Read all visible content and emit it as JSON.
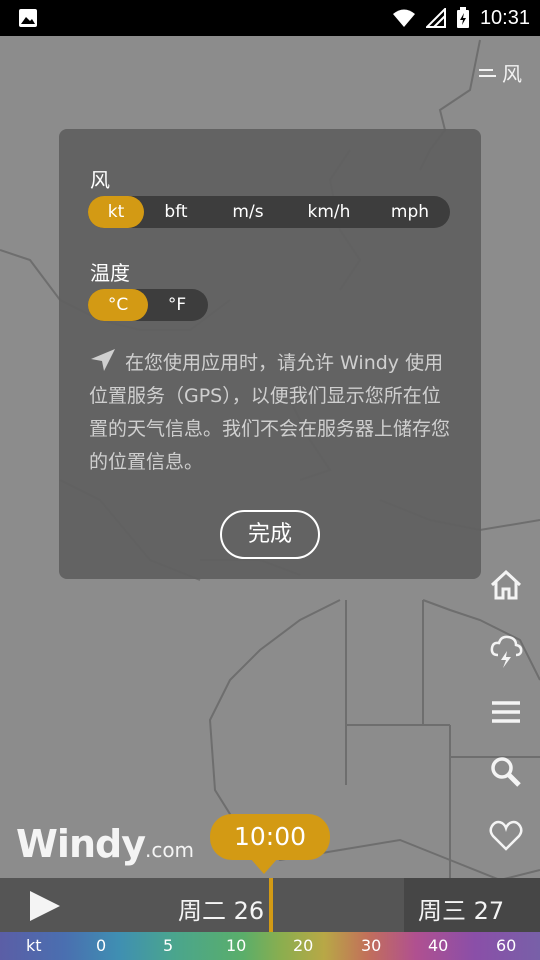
{
  "status_bar": {
    "time": "10:31"
  },
  "map_layer": {
    "label": "风"
  },
  "dialog": {
    "wind_label": "风",
    "wind_units": [
      {
        "label": "kt",
        "active": true
      },
      {
        "label": "bft",
        "active": false
      },
      {
        "label": "m/s",
        "active": false
      },
      {
        "label": "km/h",
        "active": false
      },
      {
        "label": "mph",
        "active": false
      }
    ],
    "temp_label": "温度",
    "temp_units": [
      {
        "label": "°C",
        "active": true
      },
      {
        "label": "°F",
        "active": false
      }
    ],
    "info_text": "在您使用应用时，请允许 Windy 使用位置服务（GPS），以便我们显示您所在位置的天气信息。我们不会在服务器上储存您的位置信息。",
    "done_label": "完成"
  },
  "logo": {
    "main": "Windy",
    "suffix": ".com"
  },
  "timeline": {
    "current_time": "10:00",
    "today": "周二 26",
    "next_day": "周三 27"
  },
  "legend": {
    "unit": "kt",
    "ticks": [
      "0",
      "5",
      "10",
      "20",
      "30",
      "40",
      "60"
    ]
  },
  "colors": {
    "accent": "#d39a14",
    "dialog_bg": "#606060",
    "map_bg": "#8c8c8c"
  }
}
